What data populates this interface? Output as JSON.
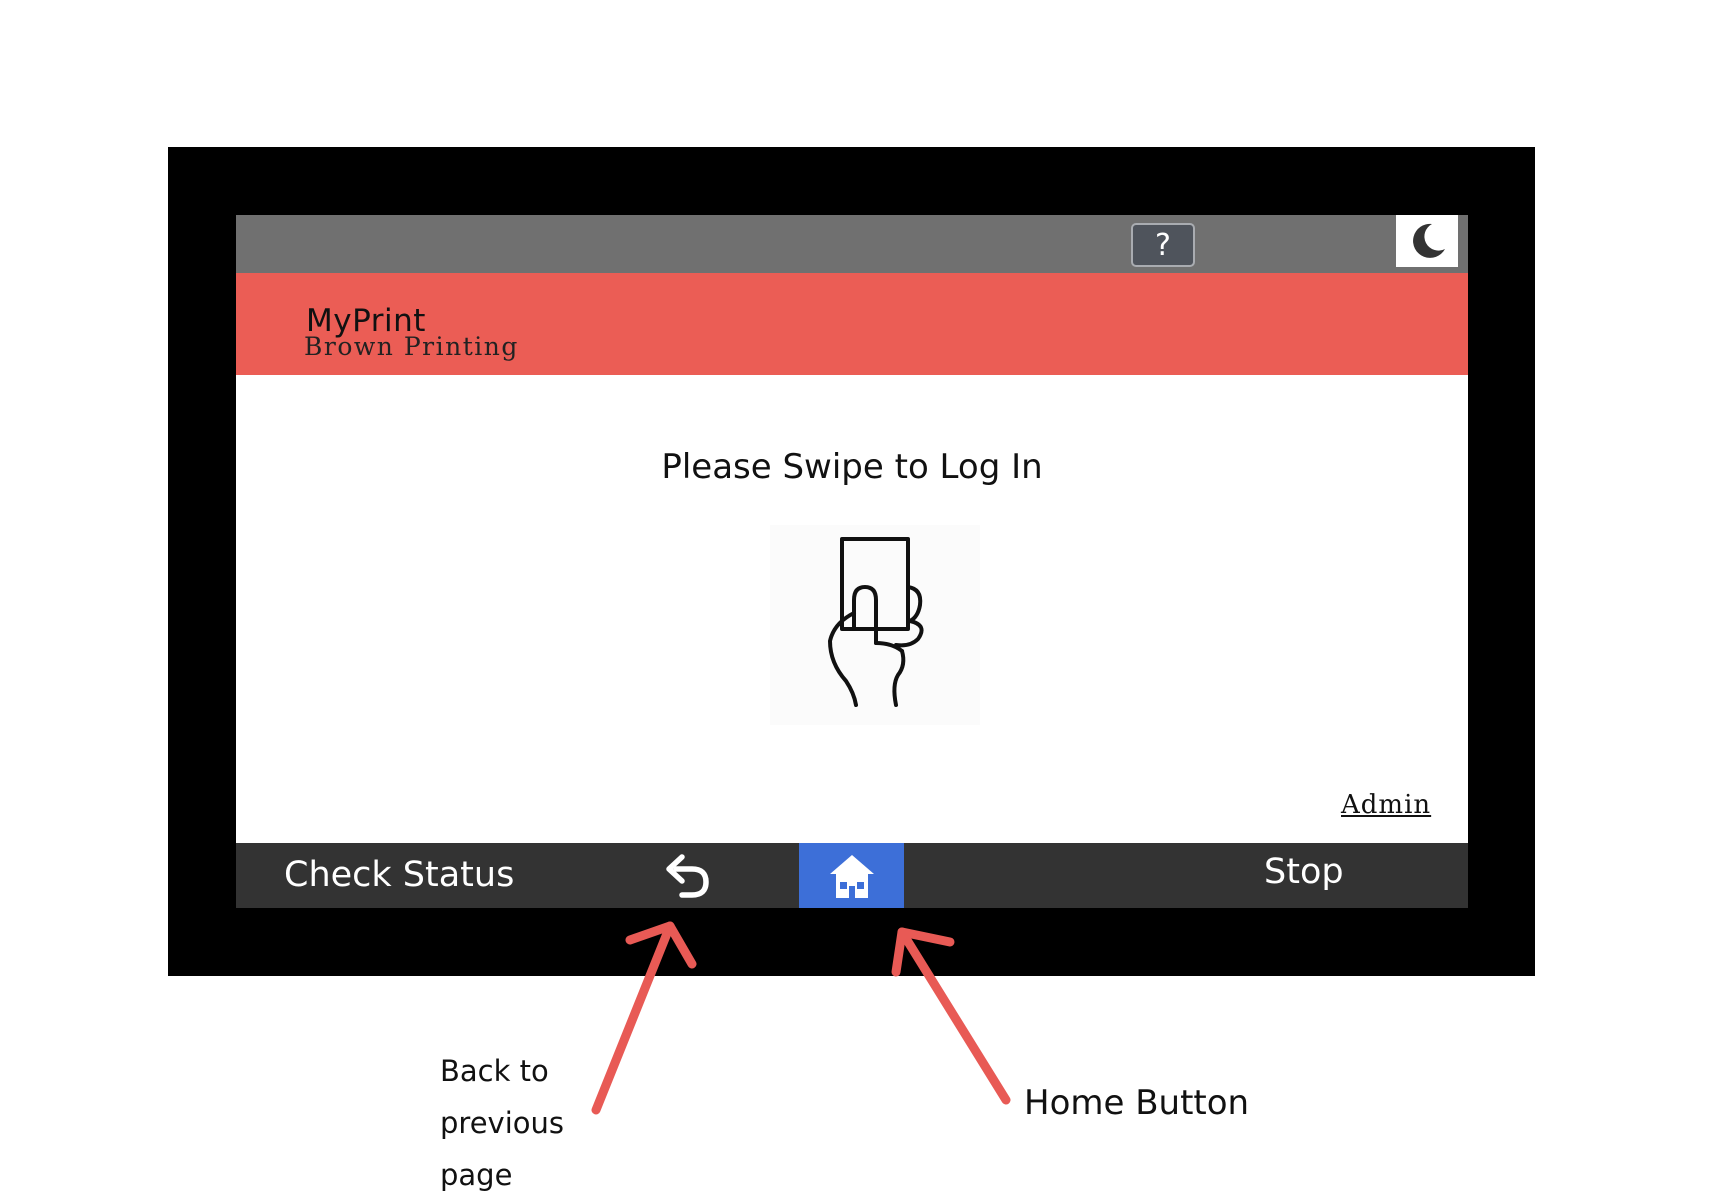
{
  "header": {
    "help_label": "?",
    "sleep_icon": "moon-icon"
  },
  "brand": {
    "name": "MyPrint",
    "subtitle": "Brown Printing"
  },
  "main": {
    "prompt": "Please Swipe to Log In",
    "illustration_icon": "hand-holding-card-icon",
    "admin_link": "Admin"
  },
  "footer": {
    "check_status_label": "Check Status",
    "back_icon": "undo-arrow-icon",
    "home_icon": "house-icon",
    "stop_label": "Stop"
  },
  "annotations": {
    "back_callout_lines": [
      "Back to",
      "previous",
      "page"
    ],
    "home_callout": "Home Button"
  },
  "colors": {
    "bezel": "#000000",
    "top_bar": "#707070",
    "brand_bar": "#eb5d55",
    "bottom_bar": "#333333",
    "home_accent": "#3d6fd8",
    "annotation_arrow": "#e85a55"
  }
}
